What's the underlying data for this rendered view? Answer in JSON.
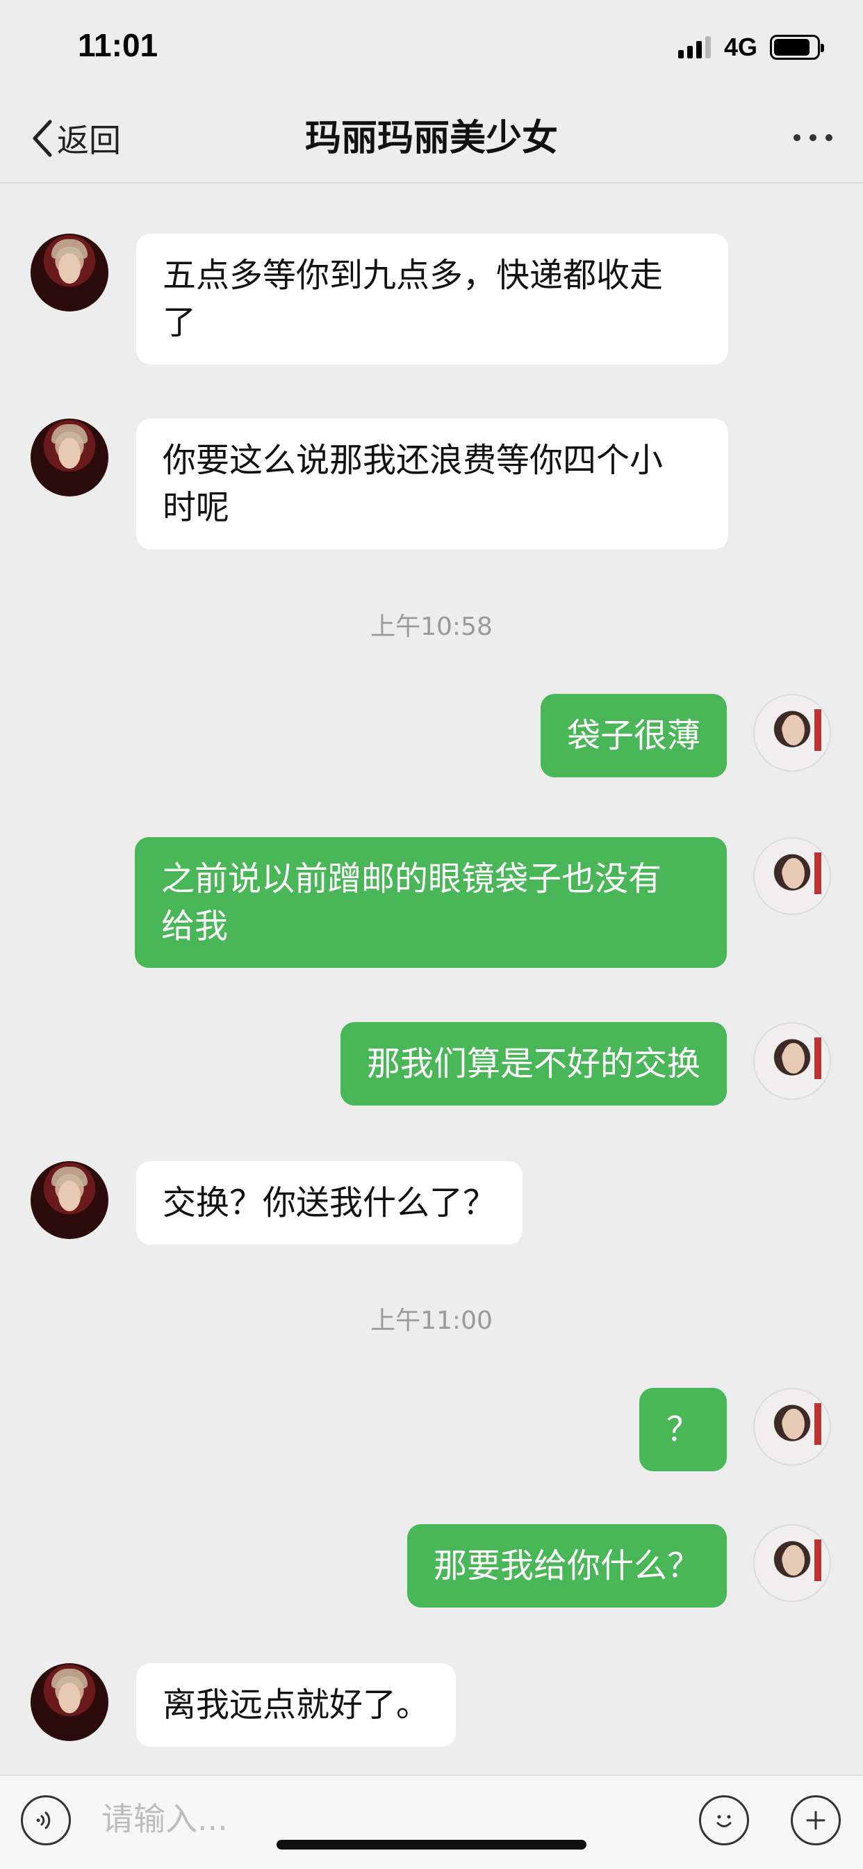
{
  "status_bar": {
    "time": "11:01",
    "network": "4G",
    "battery_level": 0.85,
    "signal_bars": 3
  },
  "nav": {
    "back_label": "返回",
    "title": "玛丽玛丽美少女"
  },
  "messages": [
    {
      "side": "in",
      "text": "五点多等你到九点多，快递都收走\n了"
    },
    {
      "side": "in",
      "text": "你要这么说那我还浪费等你四个小\n时呢"
    },
    {
      "side": "time",
      "text": "上午10:58"
    },
    {
      "side": "out",
      "text": "袋子很薄"
    },
    {
      "side": "out",
      "text": "之前说以前蹭邮的眼镜袋子也没有\n给我"
    },
    {
      "side": "out",
      "text": "那我们算是不好的交换"
    },
    {
      "side": "in",
      "text": "交换？你送我什么了？"
    },
    {
      "side": "time",
      "text": "上午11:00"
    },
    {
      "side": "out",
      "text": "？"
    },
    {
      "side": "out",
      "text": "那要我给你什么？"
    },
    {
      "side": "in",
      "text": "离我远点就好了。"
    }
  ],
  "input": {
    "placeholder": "请输入..."
  },
  "colors": {
    "background": "#ededed",
    "outgoing_bubble": "#49b657",
    "incoming_bubble": "#ffffff"
  }
}
